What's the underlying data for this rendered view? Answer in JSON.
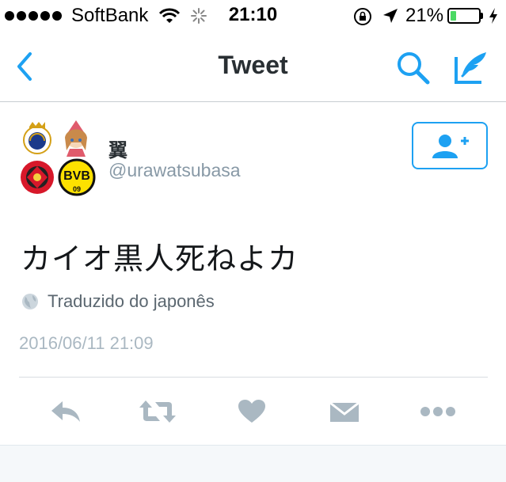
{
  "status_bar": {
    "carrier": "SoftBank",
    "time": "21:10",
    "battery_percent": "21%",
    "battery_level": 0.21,
    "icons": [
      "signal-dots-icon",
      "wifi-icon",
      "activity-spinner-icon",
      "rotation-lock-icon",
      "location-arrow-icon",
      "battery-icon",
      "charging-bolt-icon"
    ]
  },
  "nav": {
    "title": "Tweet",
    "accent_color": "#1da1f2",
    "icons": [
      "back-chevron-icon",
      "search-icon",
      "compose-icon"
    ]
  },
  "tweet": {
    "display_name": "翼",
    "handle": "@urawatsubasa",
    "text": "カイオ黒人死ねよカ",
    "translated_label": "Traduzido do japonês",
    "timestamp": "2016/06/11 21:09"
  },
  "actions": {
    "icons": [
      "reply-icon",
      "retweet-icon",
      "like-heart-icon",
      "direct-message-icon",
      "more-icon"
    ],
    "color": "#aab8c2"
  }
}
